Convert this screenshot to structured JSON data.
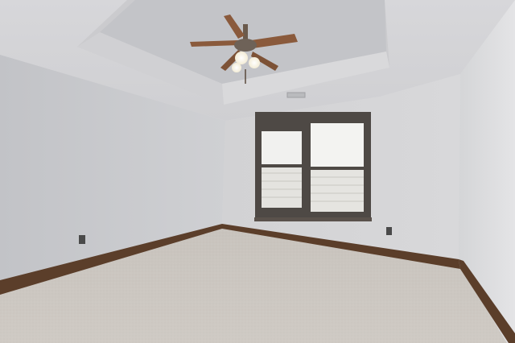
{
  "scene": {
    "subject": "empty-bedroom-interior",
    "colors": {
      "ceiling": "#d3d3d6",
      "tray_ceiling": "#c6c7ca",
      "left_wall": "#c9cacd",
      "back_wall": "#d4d4d6",
      "right_wall": "#dcdcde",
      "carpet": "#cbc6c0",
      "baseboard": "#5b3e2a",
      "window_frame": "#4e4945",
      "window_glass": "#f1f1ef",
      "fan_blade": "#8a5a3c",
      "fan_light": "#fbf6e6"
    },
    "elements": [
      "ceiling-fan-icon",
      "double-window",
      "baseboard",
      "electrical-outlet-icon",
      "carpet-floor",
      "tray-ceiling",
      "air-vent-icon"
    ]
  }
}
